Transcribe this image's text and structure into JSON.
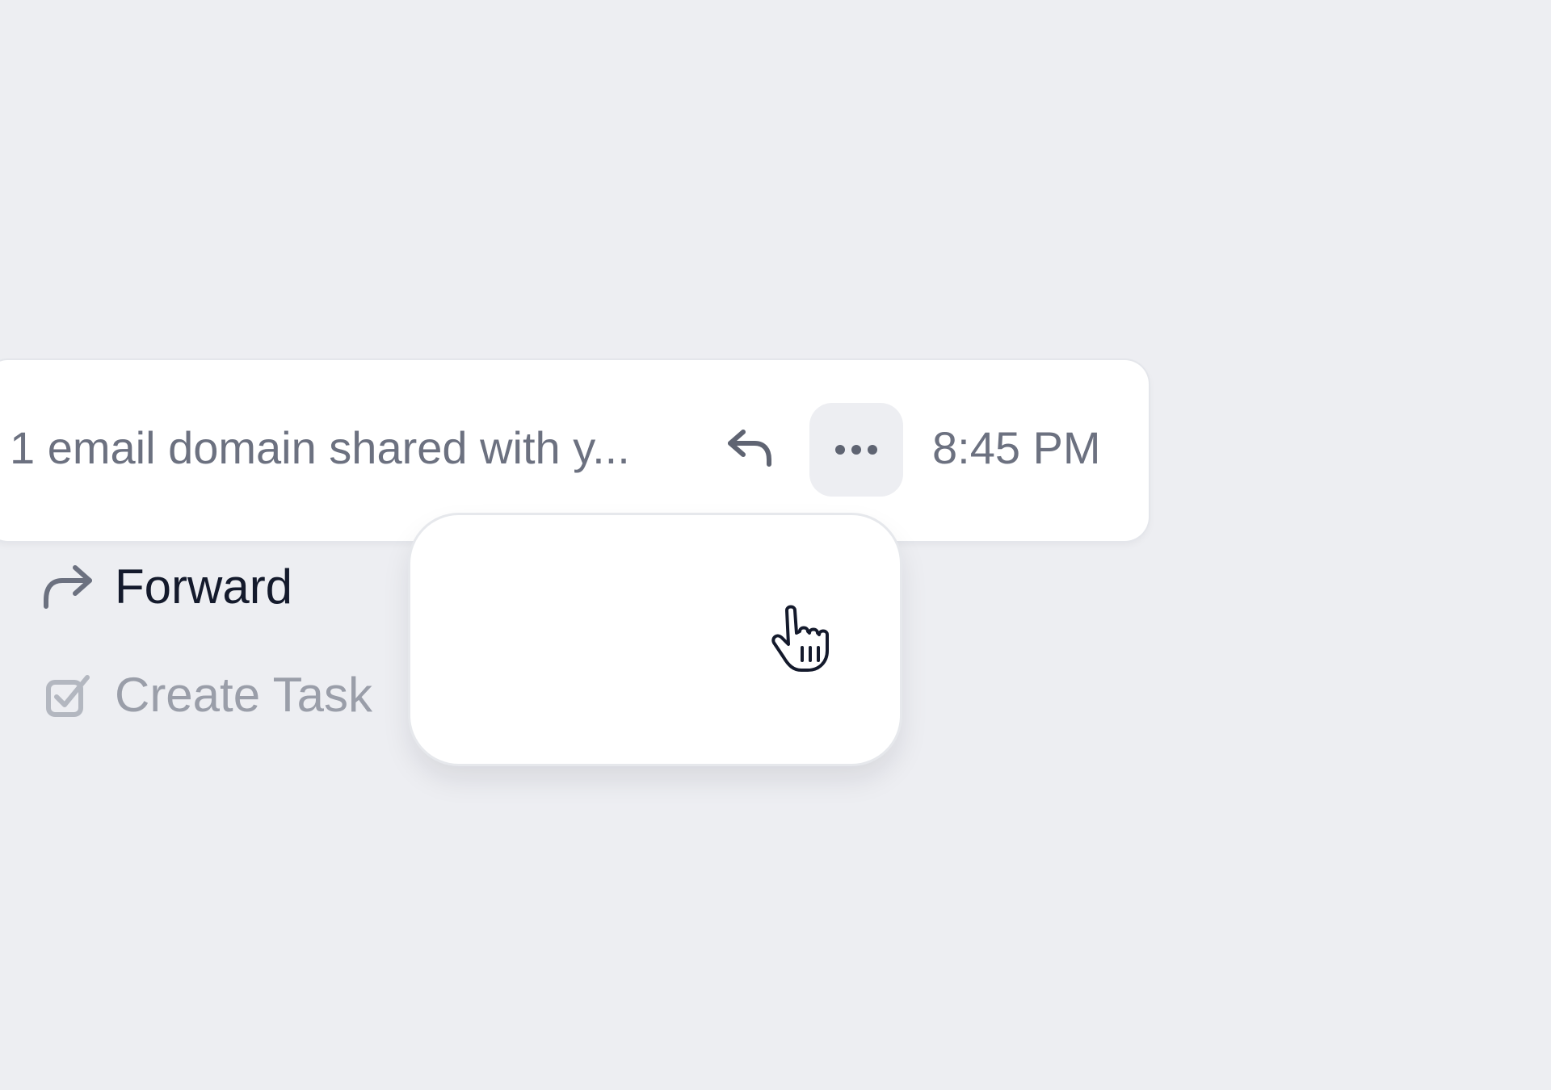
{
  "email_row": {
    "subject": "1 email domain shared with y...",
    "time": "8:45 PM",
    "reply_icon": "reply-icon",
    "more_icon": "more-horizontal-icon"
  },
  "menu": {
    "items": [
      {
        "label": "Forward",
        "icon": "forward-icon",
        "state": "enabled"
      },
      {
        "label": "Create Task",
        "icon": "checkbox-icon",
        "state": "disabled"
      }
    ]
  },
  "cursor": {
    "icon": "hand-pointer-cursor-icon"
  },
  "colors": {
    "background": "#EDEEF2",
    "card": "#FFFFFF",
    "muted_text": "#6C7180",
    "primary_text": "#141A2C",
    "disabled_text": "#9A9EA9"
  }
}
